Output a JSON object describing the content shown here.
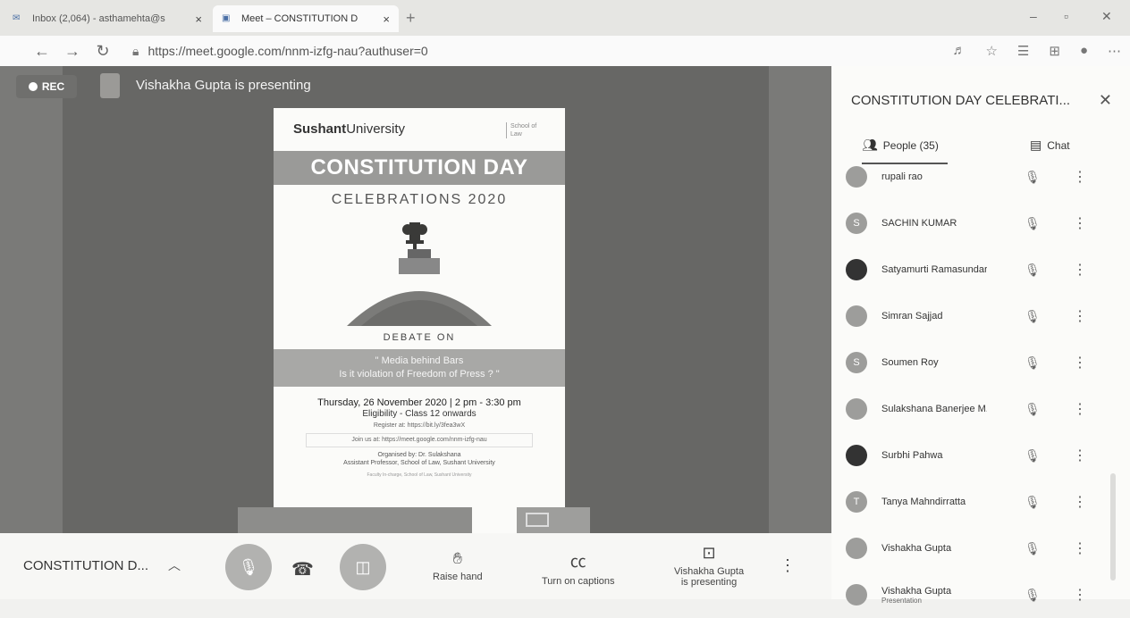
{
  "browser": {
    "tabs": [
      {
        "label": "Inbox (2,064) - asthamehta@s",
        "active": false
      },
      {
        "label": "Meet – CONSTITUTION D",
        "active": true
      }
    ],
    "url": "https://meet.google.com/nnm-izfg-nau?authuser=0"
  },
  "stage": {
    "rec_label": "REC",
    "presenting_text": "Vishakha Gupta is presenting"
  },
  "poster": {
    "logo_bold": "Sushant",
    "logo_rest": "University",
    "school": "School of Law",
    "banner": "CONSTITUTION DAY",
    "subtitle": "CELEBRATIONS 2020",
    "debate_on": "DEBATE ON",
    "topic_line1": "\" Media behind Bars",
    "topic_line2": "Is it violation of Freedom of Press ? \"",
    "date_line": "Thursday, 26 November 2020 | 2 pm - 3:30 pm",
    "eligibility": "Eligibility - Class 12 onwards",
    "register": "Register at: https://bit.ly/3fea3wX",
    "join": "Join us at: https://meet.google.com/nnm-izfg-nau",
    "organised_by": "Organised by: Dr. Sulakshana",
    "organiser_title": "Assistant Professor, School of Law, Sushant University",
    "fine_print": "Faculty In-charge, School of Law, Sushant University"
  },
  "bottom_bar": {
    "meeting_name": "CONSTITUTION D...",
    "raise_hand": "Raise hand",
    "captions": "Turn on captions",
    "presenting_line1": "Vishakha Gupta",
    "presenting_line2": "is presenting"
  },
  "panel": {
    "title": "CONSTITUTION DAY CELEBRATI...",
    "people_tab": "People (35)",
    "chat_tab": "Chat",
    "participants": [
      {
        "name": "rupali rao",
        "initial": "",
        "sub": ""
      },
      {
        "name": "SACHIN KUMAR",
        "initial": "S",
        "sub": ""
      },
      {
        "name": "Satyamurti Ramasundar",
        "initial": "",
        "sub": ""
      },
      {
        "name": "Simran Sajjad",
        "initial": "",
        "sub": ""
      },
      {
        "name": "Soumen Roy",
        "initial": "S",
        "sub": ""
      },
      {
        "name": "Sulakshana Banerjee M...",
        "initial": "",
        "sub": ""
      },
      {
        "name": "Surbhi Pahwa",
        "initial": "",
        "sub": ""
      },
      {
        "name": "Tanya Mahndirratta",
        "initial": "T",
        "sub": ""
      },
      {
        "name": "Vishakha Gupta",
        "initial": "",
        "sub": ""
      },
      {
        "name": "Vishakha Gupta",
        "initial": "",
        "sub": "Presentation"
      }
    ]
  }
}
